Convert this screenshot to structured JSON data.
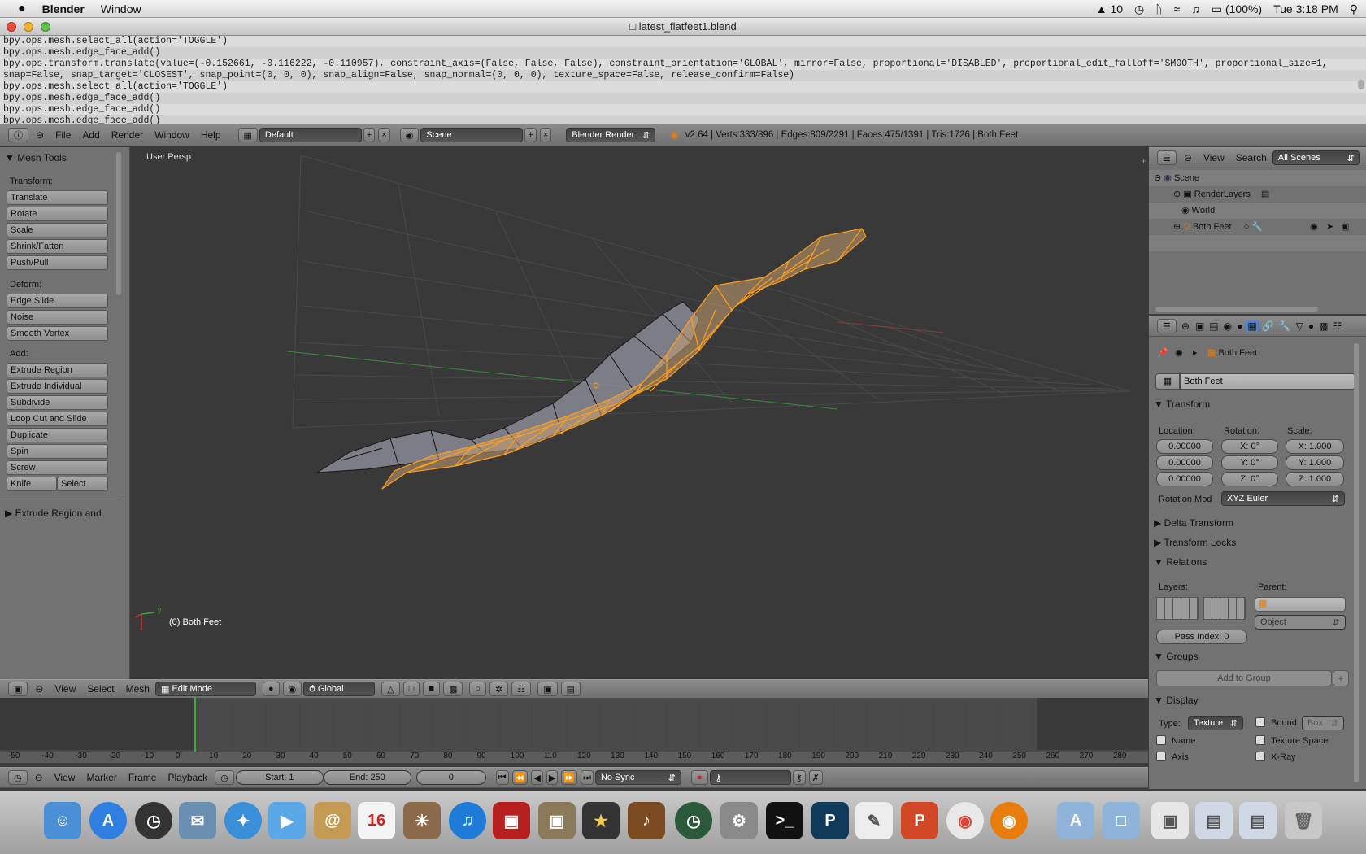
{
  "macmenu": {
    "apple": "",
    "app": "Blender",
    "window": "Window",
    "status": {
      "adobe": "10",
      "battery": "(100%)",
      "clock": "Tue 3:18 PM"
    }
  },
  "window": {
    "title": "latest_flatfeet1.blend"
  },
  "log": {
    "lines": [
      "bpy.ops.mesh.select_all(action='TOGGLE')",
      "bpy.ops.mesh.edge_face_add()",
      "bpy.ops.transform.translate(value=(-0.152661, -0.116222, -0.110957), constraint_axis=(False, False, False), constraint_orientation='GLOBAL', mirror=False, proportional='DISABLED', proportional_edit_falloff='SMOOTH', proportional_size=1,",
      " snap=False, snap_target='CLOSEST', snap_point=(0, 0, 0), snap_align=False, snap_normal=(0, 0, 0), texture_space=False, release_confirm=False)",
      "bpy.ops.mesh.select_all(action='TOGGLE')",
      "bpy.ops.mesh.edge_face_add()",
      "bpy.ops.mesh.edge_face_add()",
      "bpy.ops.mesh.edge_face_add()"
    ]
  },
  "infobar": {
    "menus": [
      "File",
      "Add",
      "Render",
      "Window",
      "Help"
    ],
    "layout": "Default",
    "scene": "Scene",
    "engine": "Blender Render",
    "stats": "v2.64 | Verts:333/896 | Edges:809/2291 | Faces:475/1391 | Tris:1726 | Both Feet"
  },
  "tools": {
    "title": "Mesh Tools",
    "transform_label": "Transform:",
    "transform": [
      "Translate",
      "Rotate",
      "Scale",
      "Shrink/Fatten",
      "Push/Pull"
    ],
    "deform_label": "Deform:",
    "deform": [
      "Edge Slide",
      "Noise",
      "Smooth Vertex"
    ],
    "add_label": "Add:",
    "add": [
      "Extrude Region",
      "Extrude Individual",
      "Subdivide",
      "Loop Cut and Slide",
      "Duplicate",
      "Spin",
      "Screw"
    ],
    "knife": "Knife",
    "select": "Select",
    "operator": "Extrude Region and"
  },
  "viewport": {
    "view_name": "User Persp",
    "object_name": "(0) Both Feet",
    "axis_y": "y"
  },
  "viewheader": {
    "menus": [
      "View",
      "Select",
      "Mesh"
    ],
    "mode": "Edit Mode",
    "orientation": "Global"
  },
  "outliner": {
    "menus": [
      "View",
      "Search"
    ],
    "scope": "All Scenes",
    "items": [
      "Scene",
      "RenderLayers",
      "World",
      "Both Feet"
    ]
  },
  "properties": {
    "breadcrumb": "Both Feet",
    "object_name": "Both Feet",
    "transform": {
      "title": "Transform",
      "location_label": "Location:",
      "rotation_label": "Rotation:",
      "scale_label": "Scale:",
      "location": [
        "0.00000",
        "0.00000",
        "0.00000"
      ],
      "rotation": [
        "X: 0°",
        "Y: 0°",
        "Z: 0°"
      ],
      "scale": [
        "X: 1.000",
        "Y: 1.000",
        "Z: 1.000"
      ],
      "rotation_mode_label": "Rotation Mod",
      "rotation_mode": "XYZ Euler"
    },
    "delta_transform": "Delta Transform",
    "transform_locks": "Transform Locks",
    "relations": {
      "title": "Relations",
      "layers_label": "Layers:",
      "parent_label": "Parent:",
      "parent_type": "Object",
      "pass_index": "Pass Index: 0"
    },
    "groups": {
      "title": "Groups",
      "add_button": "Add to Group"
    },
    "display": {
      "title": "Display",
      "type_label": "Type:",
      "type": "Texture",
      "bound": "Bound",
      "bound_type": "Box",
      "name": "Name",
      "texture_space": "Texture Space",
      "axis": "Axis",
      "xray": "X-Ray"
    }
  },
  "timeline": {
    "ticks": [
      "-50",
      "-40",
      "-30",
      "-20",
      "-10",
      "0",
      "10",
      "20",
      "30",
      "40",
      "50",
      "60",
      "70",
      "80",
      "90",
      "100",
      "110",
      "120",
      "130",
      "140",
      "150",
      "160",
      "170",
      "180",
      "190",
      "200",
      "210",
      "220",
      "230",
      "240",
      "250",
      "260",
      "270",
      "280"
    ],
    "menus": [
      "View",
      "Marker",
      "Frame",
      "Playback"
    ],
    "start": "Start: 1",
    "end": "End: 250",
    "current": "0",
    "sync": "No Sync"
  },
  "colors": {
    "selected": "#ffa020",
    "panel": "#727272",
    "viewport": "#393939"
  }
}
